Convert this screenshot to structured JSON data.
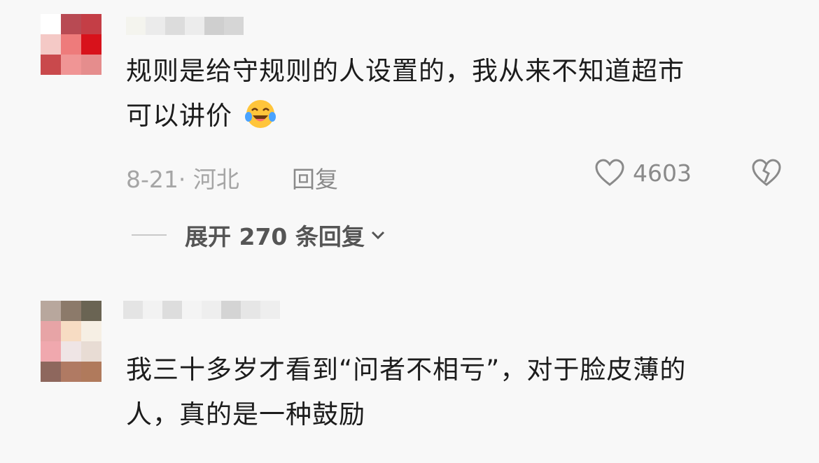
{
  "comments": [
    {
      "text_line1": "规则是给守规则的人设置的，我从来不知道超市",
      "text_line2": "可以讲价",
      "emoji": "laughing-crying-emoji",
      "meta": "8-21· 河北",
      "reply_label": "回复",
      "like_count": "4603",
      "expand_label": "展开 270 条回复"
    },
    {
      "text_line1": "我三十多岁才看到“问者不相亏”，对于脸皮薄的",
      "text_line2": "人，真的是一种鼓励"
    }
  ],
  "icons": {
    "like": "heart-outline-icon",
    "dislike": "broken-heart-icon",
    "expand": "chevron-down-icon"
  },
  "colors": {
    "background": "#f8f8f8",
    "text": "#1c1c1c",
    "meta": "#a5a5a5",
    "action": "#8a8a8a"
  }
}
